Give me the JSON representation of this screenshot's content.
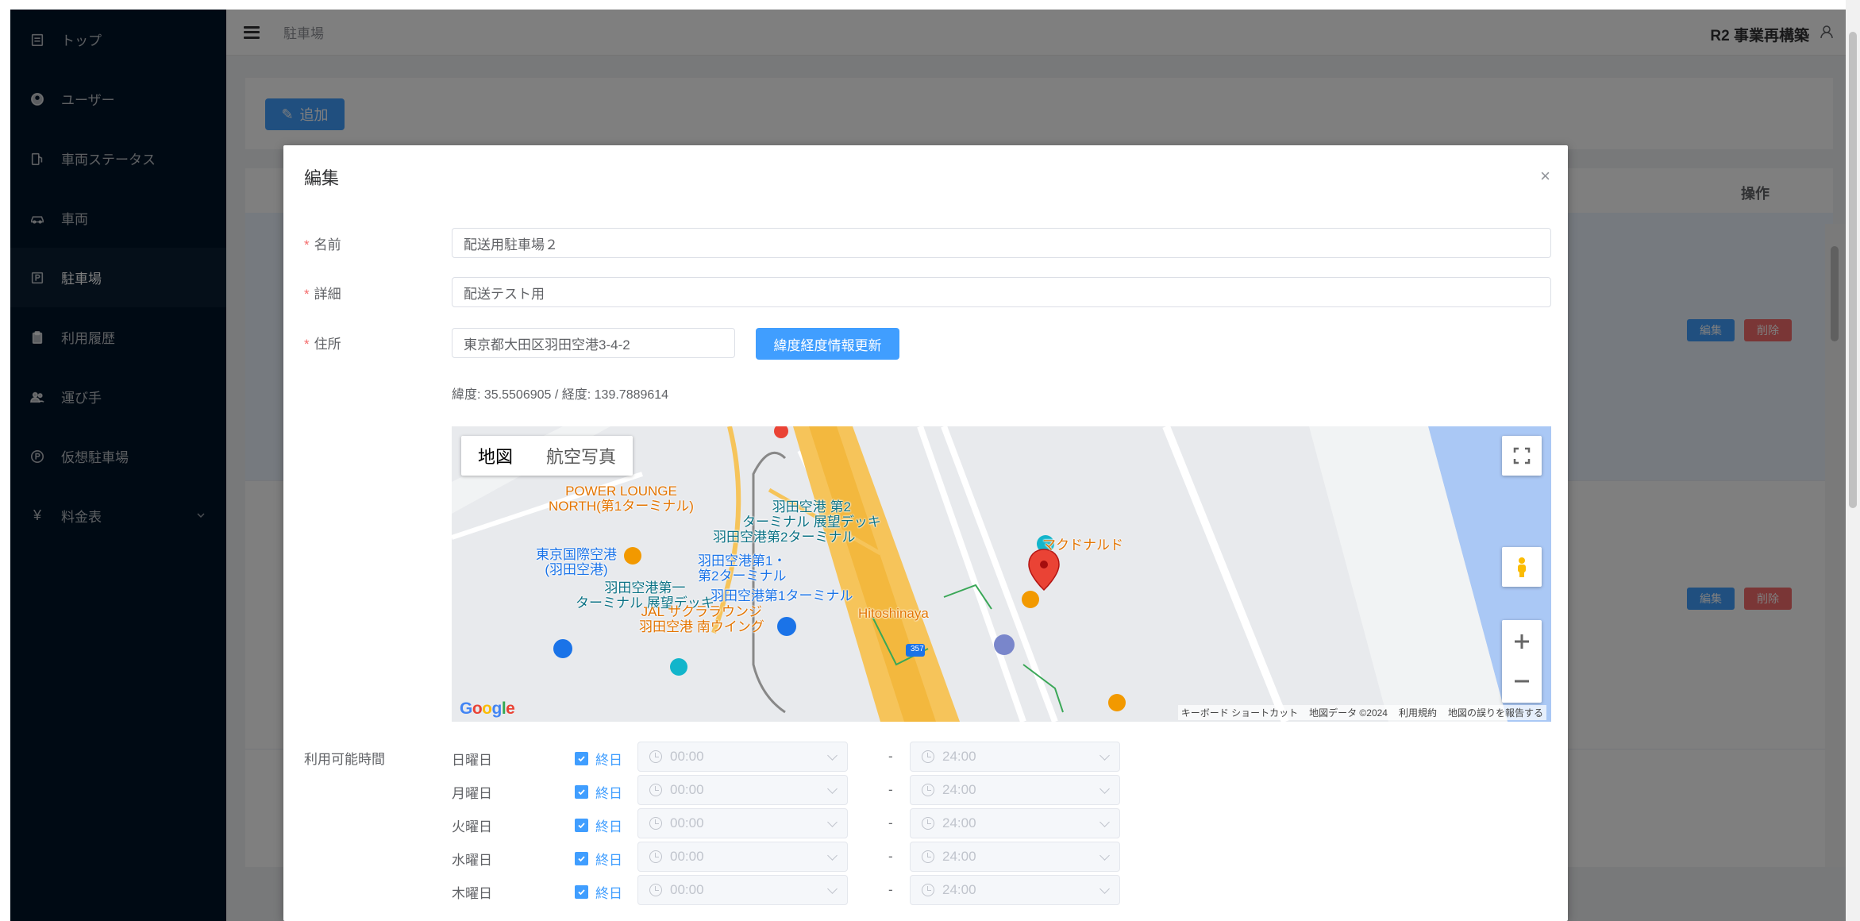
{
  "sidebar": {
    "items": [
      {
        "label": "トップ",
        "icon": "calendar-icon"
      },
      {
        "label": "ユーザー",
        "icon": "user-circle-icon"
      },
      {
        "label": "車両ステータス",
        "icon": "fuel-icon"
      },
      {
        "label": "車両",
        "icon": "car-icon"
      },
      {
        "label": "駐車場",
        "icon": "parking-icon"
      },
      {
        "label": "利用履歴",
        "icon": "clipboard-icon"
      },
      {
        "label": "運び手",
        "icon": "users-icon"
      },
      {
        "label": "仮想駐車場",
        "icon": "virtual-parking-icon"
      },
      {
        "label": "料金表",
        "icon": "yen-icon"
      }
    ],
    "active_index": 4
  },
  "header": {
    "breadcrumb": "駐車場",
    "org_name": "R2 事業再構築"
  },
  "page": {
    "add_button": "追加",
    "column_operations": "操作",
    "edit_button": "編集",
    "delete_button": "削除"
  },
  "dialog": {
    "title": "編集",
    "close": "×",
    "name_label": "名前",
    "name_value": "配送用駐車場２",
    "detail_label": "詳細",
    "detail_value": "配送テスト用",
    "address_label": "住所",
    "address_value": "東京都大田区羽田空港3-4-2",
    "geo_button": "緯度経度情報更新",
    "coords_text": "緯度: 35.5506905 / 経度: 139.7889614",
    "hours_label": "利用可能時間",
    "allday_label": "終日",
    "dash": "-",
    "days": [
      {
        "day": "日曜日",
        "start": "00:00",
        "end": "24:00"
      },
      {
        "day": "月曜日",
        "start": "00:00",
        "end": "24:00"
      },
      {
        "day": "火曜日",
        "start": "00:00",
        "end": "24:00"
      },
      {
        "day": "水曜日",
        "start": "00:00",
        "end": "24:00"
      },
      {
        "day": "木曜日",
        "start": "00:00",
        "end": "24:00"
      }
    ]
  },
  "map": {
    "type_map": "地図",
    "type_satellite": "航空写真",
    "labels": {
      "lounge": "POWER LOUNGE\nNORTH(第1ターミナル)",
      "deck2": "羽田空港 第2\nターミナル 展望デッキ",
      "t2": "羽田空港第2ターミナル",
      "mcd": "マクドナルド",
      "airport": "東京国際空港\n(羽田空港)",
      "station": "羽田空港第1・\n第2ターミナル",
      "deck1": "羽田空港第一\nターミナル 展望デッキ",
      "t1": "羽田空港第1ターミナル",
      "jal": "JAL サクララウンジ\n羽田空港 南ウイング",
      "hitoshinaya": "Hitoshinaya",
      "route": "357"
    },
    "google": "Google",
    "footer": [
      "キーボード ショートカット",
      "地図データ ©2024",
      "利用規約",
      "地図の誤りを報告する"
    ]
  }
}
